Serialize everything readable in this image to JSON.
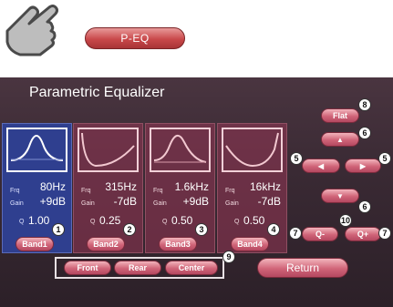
{
  "top": {
    "tab_label": "P-EQ"
  },
  "screen": {
    "title": "Parametric Equalizer"
  },
  "bands": [
    {
      "freq_label": "Frq",
      "freq": "80Hz",
      "gain_label": "Gain",
      "gain": "+9dB",
      "q_label": "Q",
      "q": "1.00",
      "button": "Band1",
      "badge": "1",
      "shape": "peak"
    },
    {
      "freq_label": "Frq",
      "freq": "315Hz",
      "gain_label": "Gain",
      "gain": "-7dB",
      "q_label": "Q",
      "q": "0.25",
      "button": "Band2",
      "badge": "2",
      "shape": "dip"
    },
    {
      "freq_label": "Frq",
      "freq": "1.6kHz",
      "gain_label": "Gain",
      "gain": "+9dB",
      "q_label": "Q",
      "q": "0.50",
      "button": "Band3",
      "badge": "3",
      "shape": "peak"
    },
    {
      "freq_label": "Frq",
      "freq": "16kHz",
      "gain_label": "Gain",
      "gain": "-7dB",
      "q_label": "Q",
      "q": "0.50",
      "button": "Band4",
      "badge": "4",
      "shape": "dip"
    }
  ],
  "controls": {
    "flat": "Flat",
    "flat_badge": "8",
    "up_badge": "6",
    "down_badge": "6",
    "left_badge": "5",
    "right_badge": "5",
    "q_minus": "Q-",
    "q_plus": "Q+",
    "q_minus_badge": "7",
    "q_plus_badge": "7",
    "q_center_badge": "10"
  },
  "speakers": {
    "front": "Front",
    "rear": "Rear",
    "center": "Center",
    "badge": "9"
  },
  "return_label": "Return",
  "colors": {
    "selected_band": "#2f3f8f",
    "unselected_band": "#96375580",
    "button": "#d06478"
  }
}
